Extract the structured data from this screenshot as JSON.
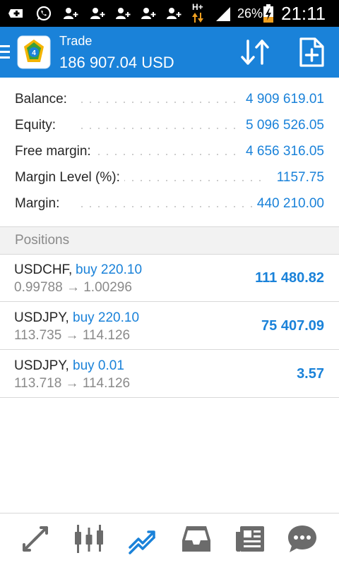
{
  "statusbar": {
    "battery_percent": "26%",
    "network_label": "H+",
    "time": "21:11"
  },
  "appbar": {
    "title": "Trade",
    "subtitle": "186 907.04 USD"
  },
  "summary": [
    {
      "label": "Balance:",
      "value": "4 909 619.01"
    },
    {
      "label": "Equity:",
      "value": "5 096 526.05"
    },
    {
      "label": "Free margin:",
      "value": "4 656 316.05"
    },
    {
      "label": "Margin Level (%):",
      "value": "1157.75"
    },
    {
      "label": "Margin:",
      "value": "440 210.00"
    }
  ],
  "positions_header": "Positions",
  "positions": [
    {
      "symbol": "USDCHF,",
      "side": "buy 220.10",
      "prices": "0.99788 → 1.00296",
      "profit": "111 480.82"
    },
    {
      "symbol": "USDJPY,",
      "side": "buy 220.10",
      "prices": "113.735 → 114.126",
      "profit": "75 407.09"
    },
    {
      "symbol": "USDJPY,",
      "side": "buy 0.01",
      "prices": "113.718 → 114.126",
      "profit": "3.57"
    }
  ],
  "bottom_tabs": [
    {
      "icon": "quotes-arrows-icon",
      "active": false
    },
    {
      "icon": "candlestick-chart-icon",
      "active": false
    },
    {
      "icon": "trade-trend-icon",
      "active": true
    },
    {
      "icon": "history-inbox-icon",
      "active": false
    },
    {
      "icon": "news-icon",
      "active": false
    },
    {
      "icon": "chat-bubble-icon",
      "active": false
    }
  ],
  "colors": {
    "accent": "#1a82d9",
    "text_dark": "#262626",
    "text_muted": "#8a8a8a",
    "icon_gray": "#6b6b6b"
  }
}
